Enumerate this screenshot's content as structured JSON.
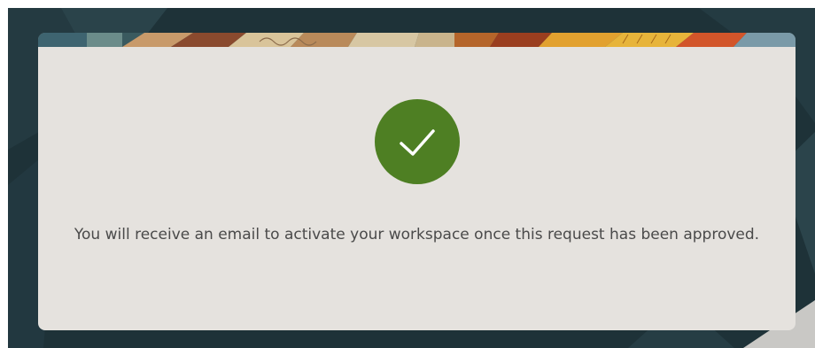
{
  "dialog": {
    "status_icon": "checkmark-icon",
    "message": "You will receive an email to activate your workspace once this request has been approved."
  },
  "colors": {
    "backdrop": "#1f3238",
    "card_background": "#e5e2de",
    "success_green": "#4e7f23",
    "message_text": "#4a4a4a"
  }
}
